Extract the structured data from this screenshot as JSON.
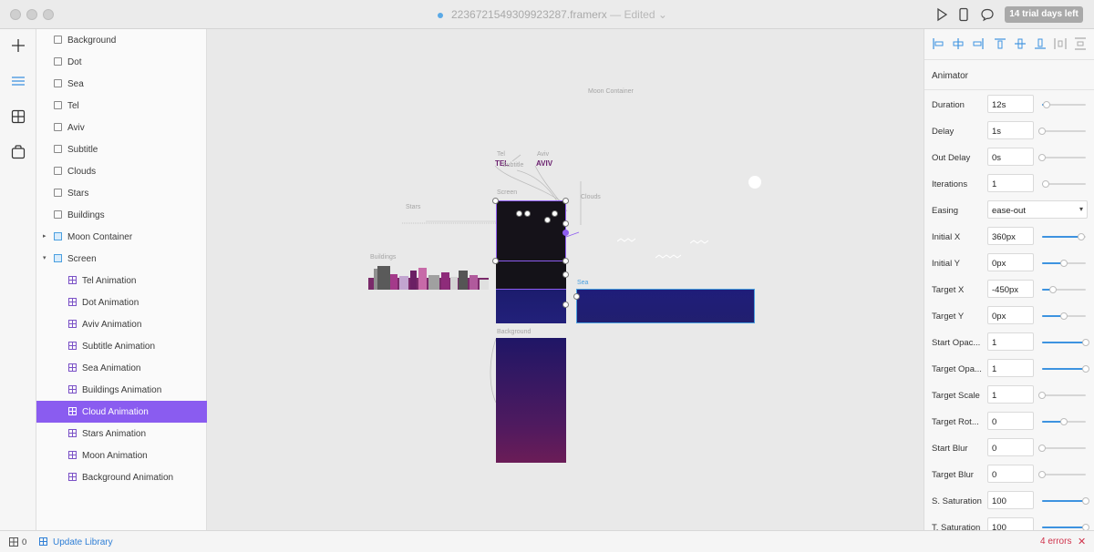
{
  "window": {
    "title": "2236721549309923287.framerx",
    "edited_label": "— Edited ⌄",
    "trial_badge": "14 trial days left"
  },
  "toolbar": {
    "icons": [
      "play-icon",
      "device-icon",
      "comment-icon"
    ]
  },
  "rail": {
    "icons": [
      "insert-icon",
      "layers-icon",
      "components-icon",
      "store-icon"
    ]
  },
  "layers": [
    {
      "label": "Background",
      "icon": "frame",
      "indent": 0
    },
    {
      "label": "Dot",
      "icon": "frame",
      "indent": 0
    },
    {
      "label": "Sea",
      "icon": "frame",
      "indent": 0
    },
    {
      "label": "Tel",
      "icon": "frame",
      "indent": 0
    },
    {
      "label": "Aviv",
      "icon": "frame",
      "indent": 0
    },
    {
      "label": "Subtitle",
      "icon": "frame",
      "indent": 0
    },
    {
      "label": "Clouds",
      "icon": "frame",
      "indent": 0
    },
    {
      "label": "Stars",
      "icon": "frame",
      "indent": 0
    },
    {
      "label": "Buildings",
      "icon": "frame",
      "indent": 0
    },
    {
      "label": "Moon Container",
      "icon": "frame-blue",
      "indent": 0,
      "arrow": "▸"
    },
    {
      "label": "Screen",
      "icon": "frame-blue",
      "indent": 0,
      "arrow": "▾"
    },
    {
      "label": "Tel Animation",
      "icon": "anim",
      "indent": 1
    },
    {
      "label": "Dot Animation",
      "icon": "anim",
      "indent": 1
    },
    {
      "label": "Aviv Animation",
      "icon": "anim",
      "indent": 1
    },
    {
      "label": "Subtitle Animation",
      "icon": "anim",
      "indent": 1
    },
    {
      "label": "Sea Animation",
      "icon": "anim",
      "indent": 1
    },
    {
      "label": "Buildings Animation",
      "icon": "anim",
      "indent": 1
    },
    {
      "label": "Cloud Animation",
      "icon": "anim",
      "indent": 1,
      "selected": true
    },
    {
      "label": "Stars Animation",
      "icon": "anim",
      "indent": 1
    },
    {
      "label": "Moon Animation",
      "icon": "anim",
      "indent": 1
    },
    {
      "label": "Background Animation",
      "icon": "anim",
      "indent": 1
    }
  ],
  "canvas": {
    "labels": {
      "moon_container": "Moon Container",
      "tel": "Tel",
      "aviv": "Aviv",
      "tel_text": "TEL",
      "aviv_text": "AVIV",
      "subtitle": "Subtitle",
      "screen": "Screen",
      "stars": "Stars",
      "clouds": "Clouds",
      "buildings": "Buildings",
      "sea": "Sea",
      "background": "Background"
    },
    "colors": {
      "selection": "#8d5cf0",
      "sea_selection": "#4a9fe0",
      "tel_aviv_text": "#6a1f6e"
    }
  },
  "properties": {
    "section_title": "Animator",
    "align_icons": [
      "align-left-icon",
      "align-center-h-icon",
      "align-right-icon",
      "align-top-icon",
      "align-center-v-icon",
      "align-bottom-icon",
      "distribute-h-icon",
      "distribute-v-icon"
    ],
    "rows": [
      {
        "label": "Duration",
        "value": "12s",
        "slider": 0.1
      },
      {
        "label": "Delay",
        "value": "1s",
        "slider": 0
      },
      {
        "label": "Out Delay",
        "value": "0s",
        "slider": 0
      },
      {
        "label": "Iterations",
        "value": "1",
        "slider": 0.08
      },
      {
        "label": "Easing",
        "value": "ease-out",
        "type": "select"
      },
      {
        "label": "Initial X",
        "value": "360px",
        "slider": 0.9
      },
      {
        "label": "Initial Y",
        "value": "0px",
        "slider": 0.5
      },
      {
        "label": "Target X",
        "value": "-450px",
        "slider": 0.25
      },
      {
        "label": "Target Y",
        "value": "0px",
        "slider": 0.5
      },
      {
        "label": "Start Opac...",
        "value": "1",
        "slider": 1
      },
      {
        "label": "Target Opa...",
        "value": "1",
        "slider": 1
      },
      {
        "label": "Target Scale",
        "value": "1",
        "slider": 0
      },
      {
        "label": "Target Rot...",
        "value": "0",
        "slider": 0.5
      },
      {
        "label": "Start Blur",
        "value": "0",
        "slider": 0
      },
      {
        "label": "Target Blur",
        "value": "0",
        "slider": 0
      },
      {
        "label": "S. Saturation",
        "value": "100",
        "slider": 1
      },
      {
        "label": "T. Saturation",
        "value": "100",
        "slider": 1
      }
    ],
    "accent": "#3d93e0"
  },
  "status": {
    "grid_count": "0",
    "update_library": "Update Library",
    "errors": "4 errors",
    "close": "✕"
  }
}
